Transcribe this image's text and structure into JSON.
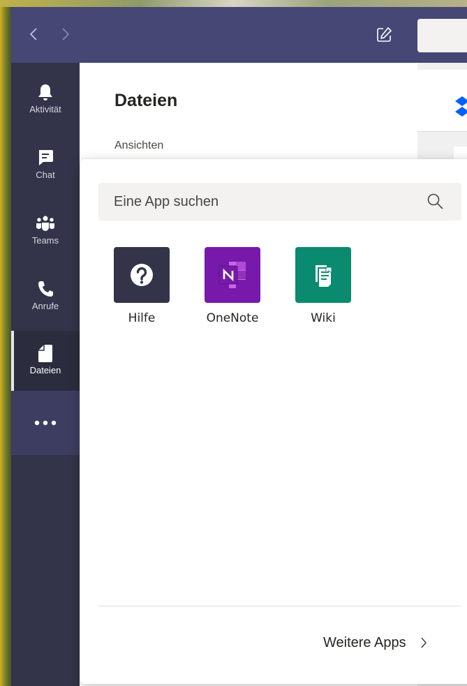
{
  "rail": {
    "items": [
      {
        "label": "Aktivität",
        "icon": "bell-icon"
      },
      {
        "label": "Chat",
        "icon": "chat-icon"
      },
      {
        "label": "Teams",
        "icon": "teams-icon"
      },
      {
        "label": "Anrufe",
        "icon": "phone-icon"
      },
      {
        "label": "Dateien",
        "icon": "file-icon"
      }
    ],
    "active": "Dateien",
    "more_icon": "more-dots-icon"
  },
  "panel": {
    "title": "Dateien",
    "subtitle": "Ansichten"
  },
  "flyout": {
    "search": {
      "placeholder": "Eine App suchen"
    },
    "apps": [
      {
        "label": "Hilfe",
        "icon": "help-question-icon",
        "color": "#33344a"
      },
      {
        "label": "OneNote",
        "icon": "onenote-icon",
        "color": "#7719aa"
      },
      {
        "label": "Wiki",
        "icon": "wiki-icon",
        "color": "#0a8a6e"
      }
    ],
    "more_apps_label": "Weitere Apps"
  },
  "colors": {
    "titlebar": "#464775",
    "rail": "#33344a",
    "accent": "#6264a7"
  }
}
